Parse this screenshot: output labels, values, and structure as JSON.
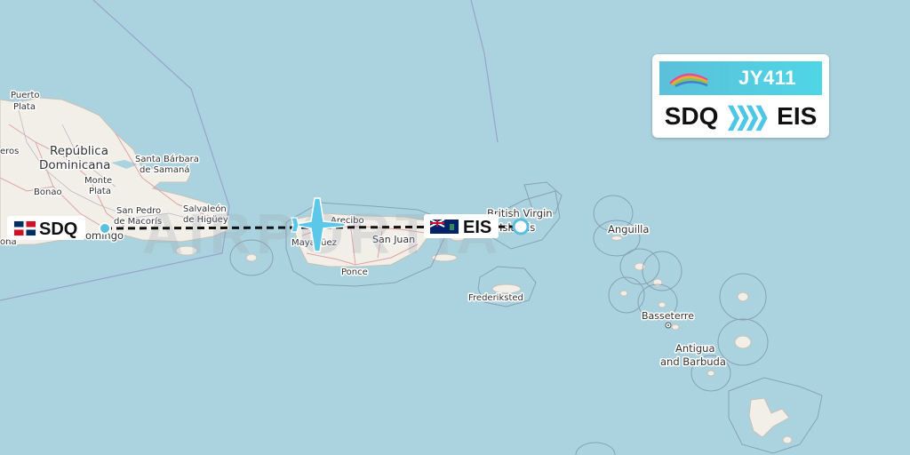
{
  "map": {
    "watermark": "AIRPORTIA",
    "places": [
      {
        "id": "puerto-plata-1",
        "text": "Puerto"
      },
      {
        "id": "puerto-plata-2",
        "text": "Plata"
      },
      {
        "id": "rep-dom-1",
        "text": "República"
      },
      {
        "id": "rep-dom-2",
        "text": "Dominicana"
      },
      {
        "id": "santa-barbara-1",
        "text": "Santa Bárbara"
      },
      {
        "id": "santa-barbara-2",
        "text": "de Samaná"
      },
      {
        "id": "monte-plata-1",
        "text": "Monte"
      },
      {
        "id": "monte-plata-2",
        "text": "Plata"
      },
      {
        "id": "bonao",
        "text": "Bonao"
      },
      {
        "id": "salvaleon-1",
        "text": "Salvaleón"
      },
      {
        "id": "salvaleon-2",
        "text": "de Higüey"
      },
      {
        "id": "san-pedro-1",
        "text": "San Pedro"
      },
      {
        "id": "san-pedro-2",
        "text": "de Macorís"
      },
      {
        "id": "santo-domingo",
        "text": "omingo"
      },
      {
        "id": "balleros",
        "text": "eros"
      },
      {
        "id": "barahona",
        "text": "ona"
      },
      {
        "id": "arecibo",
        "text": "Arecibo"
      },
      {
        "id": "mayaguez",
        "text": "Mayagüez"
      },
      {
        "id": "san-juan",
        "text": "San Juan"
      },
      {
        "id": "ponce",
        "text": "Ponce"
      },
      {
        "id": "bvi-1",
        "text": "British Virgin"
      },
      {
        "id": "bvi-2",
        "text": "Islands"
      },
      {
        "id": "frederiksted",
        "text": "Frederiksted"
      },
      {
        "id": "anguilla",
        "text": "Anguilla"
      },
      {
        "id": "basseterre",
        "text": "Basseterre"
      },
      {
        "id": "antigua-1",
        "text": "Antigua"
      },
      {
        "id": "antigua-2",
        "text": "and Barbuda"
      }
    ]
  },
  "route": {
    "origin": {
      "code": "SDQ",
      "flag": "dominican-republic-flag"
    },
    "destination": {
      "code": "EIS",
      "flag": "british-virgin-islands-flag"
    }
  },
  "flight_card": {
    "flight_number": "JY411",
    "origin": "SDQ",
    "destination": "EIS",
    "arrow": "❯❯❯❯",
    "logo": "airline-logo-icon"
  },
  "colors": {
    "sea": "#aad3df",
    "land": "#f2efe9",
    "accent": "#4fc6e6",
    "route_line": "#111111"
  }
}
